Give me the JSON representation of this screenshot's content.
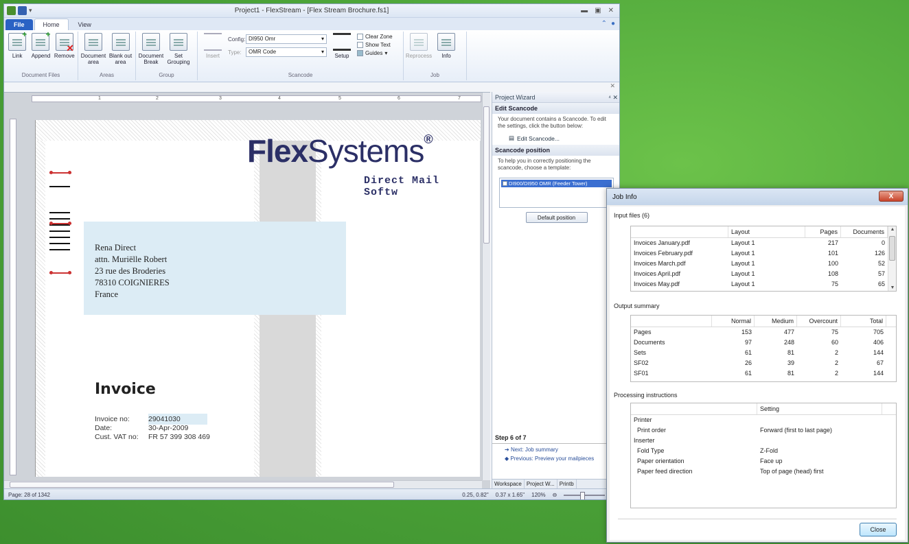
{
  "app": {
    "title": "Project1 - FlexStream - [Flex Stream Brochure.fs1]",
    "tabs": [
      "File",
      "Home",
      "View"
    ],
    "ribbon": {
      "groups": [
        {
          "label": "Document Files",
          "buttons": [
            "Link",
            "Append",
            "Remove"
          ]
        },
        {
          "label": "Areas",
          "buttons": [
            "Document area",
            "Blank out area"
          ]
        },
        {
          "label": "Group",
          "buttons": [
            "Document Break",
            "Set Grouping"
          ]
        },
        {
          "label": "Scancode",
          "insert": "Insert",
          "config_label": "Config:",
          "config_value": "DI950 Omr",
          "type_label": "Type:",
          "type_value": "OMR Code",
          "setup": "Setup",
          "checks": [
            "Clear Zone",
            "Show Text",
            "Guides"
          ]
        },
        {
          "label": "Job",
          "buttons": [
            "Reprocess",
            "Info"
          ]
        }
      ]
    },
    "ruler_marks": [
      "1",
      "2",
      "3",
      "4",
      "5",
      "6",
      "7"
    ],
    "document": {
      "logo_bold": "Flex",
      "logo_light": "Systems",
      "logo_reg": "®",
      "tagline": "Direct Mail Softw",
      "address": [
        "Rena Direct",
        "attn. Muriëlle Robert",
        "23 rue des Broderies",
        "78310 COIGNIERES",
        "France"
      ],
      "invoice_title": "Invoice",
      "invoice_rows": [
        {
          "k": "Invoice no:",
          "v": "29041030"
        },
        {
          "k": "Date:",
          "v": "30-Apr-2009"
        },
        {
          "k": "Cust. VAT no:",
          "v": "FR 57 399 308 469"
        }
      ]
    },
    "wizard": {
      "title": "Project Wizard",
      "pin": "⁴ ✕",
      "edit_heading": "Edit Scancode",
      "edit_text": "Your document contains a Scancode. To edit the settings, click the button below:",
      "edit_link": "Edit Scancode...",
      "pos_heading": "Scancode position",
      "pos_text": "To help you in correctly positioning the scancode, choose a template:",
      "pos_item": "DI900/DI950 OMR (Feeder Tower)",
      "default_btn": "Default position",
      "step": "Step 6 of 7",
      "next": "Next: Job summary",
      "prev": "Previous: Preview your mailpieces",
      "tabs": [
        "Workspace",
        "Project W...",
        "Printb"
      ]
    },
    "status": {
      "page": "Page: 28 of 1342",
      "pos": "0.25, 0.82\"",
      "size": "0.37 x 1.65\"",
      "zoom": "120%"
    }
  },
  "dialog": {
    "title": "Job Info",
    "close_x": "X",
    "input_files": {
      "label": "Input files (6)",
      "columns": [
        "",
        "Layout",
        "Pages",
        "Documents"
      ],
      "rows": [
        [
          "Invoices January.pdf",
          "Layout 1",
          "217",
          "0"
        ],
        [
          "Invoices February.pdf",
          "Layout 1",
          "101",
          "126"
        ],
        [
          "Invoices March.pdf",
          "Layout 1",
          "100",
          "52"
        ],
        [
          "Invoices April.pdf",
          "Layout 1",
          "108",
          "57"
        ],
        [
          "Invoices May.pdf",
          "Layout 1",
          "75",
          "65"
        ]
      ]
    },
    "output_summary": {
      "label": "Output summary",
      "columns": [
        "",
        "Normal",
        "Medium",
        "Overcount",
        "Total"
      ],
      "rows": [
        [
          "Pages",
          "153",
          "477",
          "75",
          "705"
        ],
        [
          "Documents",
          "97",
          "248",
          "60",
          "406"
        ],
        [
          "Sets",
          "61",
          "81",
          "2",
          "144"
        ],
        [
          "SF02",
          "26",
          "39",
          "2",
          "67"
        ],
        [
          "SF01",
          "61",
          "81",
          "2",
          "144"
        ]
      ]
    },
    "processing": {
      "label": "Processing instructions",
      "columns": [
        "",
        "Setting"
      ],
      "rows": [
        [
          "Printer",
          ""
        ],
        [
          "  Print order",
          "Forward (first to last page)"
        ],
        [
          "Inserter",
          ""
        ],
        [
          "  Fold Type",
          "Z-Fold"
        ],
        [
          "  Paper orientation",
          "Face up"
        ],
        [
          "  Paper feed direction",
          "Top of page (head) first"
        ]
      ]
    },
    "close_button": "Close"
  }
}
